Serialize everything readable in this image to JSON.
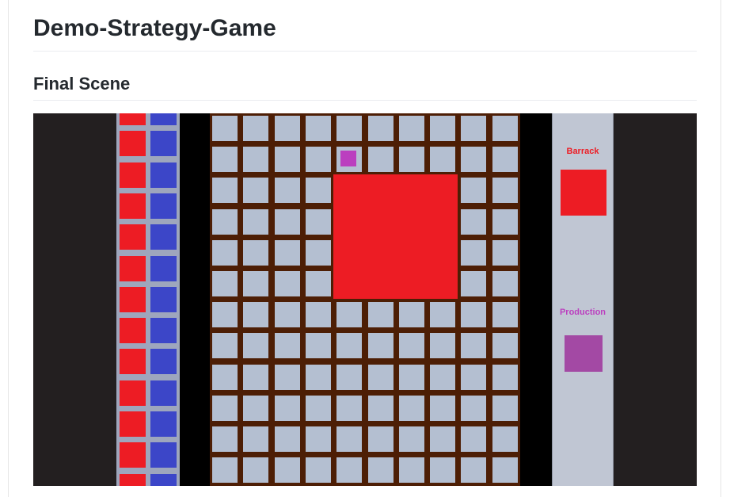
{
  "page": {
    "title": "Demo-Strategy-Game",
    "subtitle": "Final Scene"
  },
  "game": {
    "colors": {
      "barrack_red": "#ed1c24",
      "soldier_blue": "#3c46c8",
      "production_purple": "#a349a4",
      "small_unit_magenta": "#bb3fbf",
      "grid_tile": "#b4bfd1",
      "grid_border": "#4d1e05",
      "background": "#231f20"
    },
    "info_panel": {
      "barrack_label": "Barrack",
      "production_label": "Production"
    },
    "board": {
      "columns": 10,
      "rows": 12
    }
  }
}
